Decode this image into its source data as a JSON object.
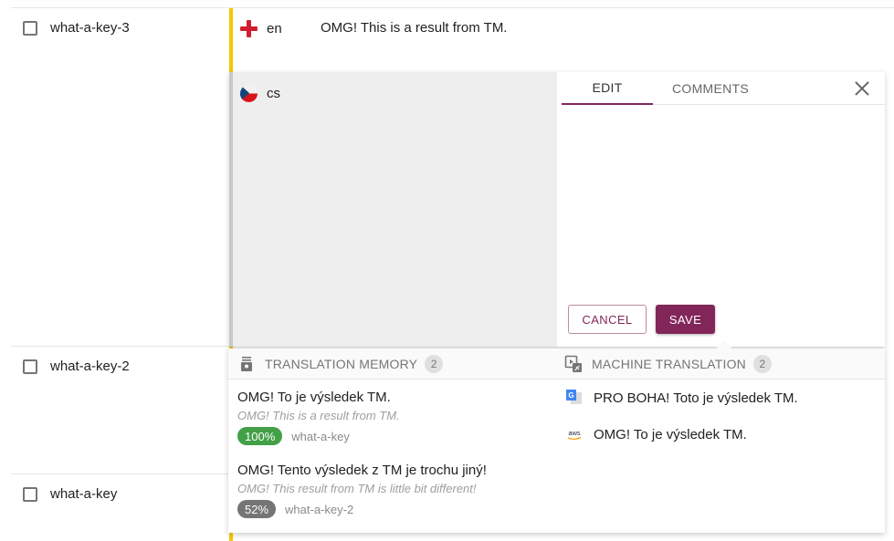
{
  "keys": [
    {
      "name": "what-a-key-3"
    },
    {
      "name": "what-a-key-2"
    },
    {
      "name": "what-a-key"
    }
  ],
  "source": {
    "lang": "en",
    "text": "OMG! This is a result from TM."
  },
  "target": {
    "lang": "cs",
    "text": ""
  },
  "editor": {
    "tabs": [
      {
        "label": "EDIT",
        "active": true
      },
      {
        "label": "COMMENTS",
        "active": false
      }
    ],
    "cancel_label": "CANCEL",
    "save_label": "SAVE"
  },
  "translation_memory": {
    "title": "TRANSLATION MEMORY",
    "count": "2",
    "items": [
      {
        "target": "OMG! To je výsledek TM.",
        "source": "OMG! This is a result from TM.",
        "match": "100%",
        "key": "what-a-key"
      },
      {
        "target": "OMG! Tento výsledek z TM je trochu jiný!",
        "source": "OMG! This result from TM is little bit different!",
        "match": "52%",
        "key": "what-a-key-2"
      }
    ]
  },
  "machine_translation": {
    "title": "MACHINE TRANSLATION",
    "count": "2",
    "items": [
      {
        "provider": "google-translate",
        "text": "PRO BOHA! Toto je výsledek TM."
      },
      {
        "provider": "aws",
        "provider_label": "aws",
        "text": "OMG! To je výsledek TM."
      }
    ]
  },
  "colors": {
    "primary": "#822659",
    "highlight": "#f5c800",
    "match_full": "#43a047",
    "match_partial": "#757575"
  }
}
